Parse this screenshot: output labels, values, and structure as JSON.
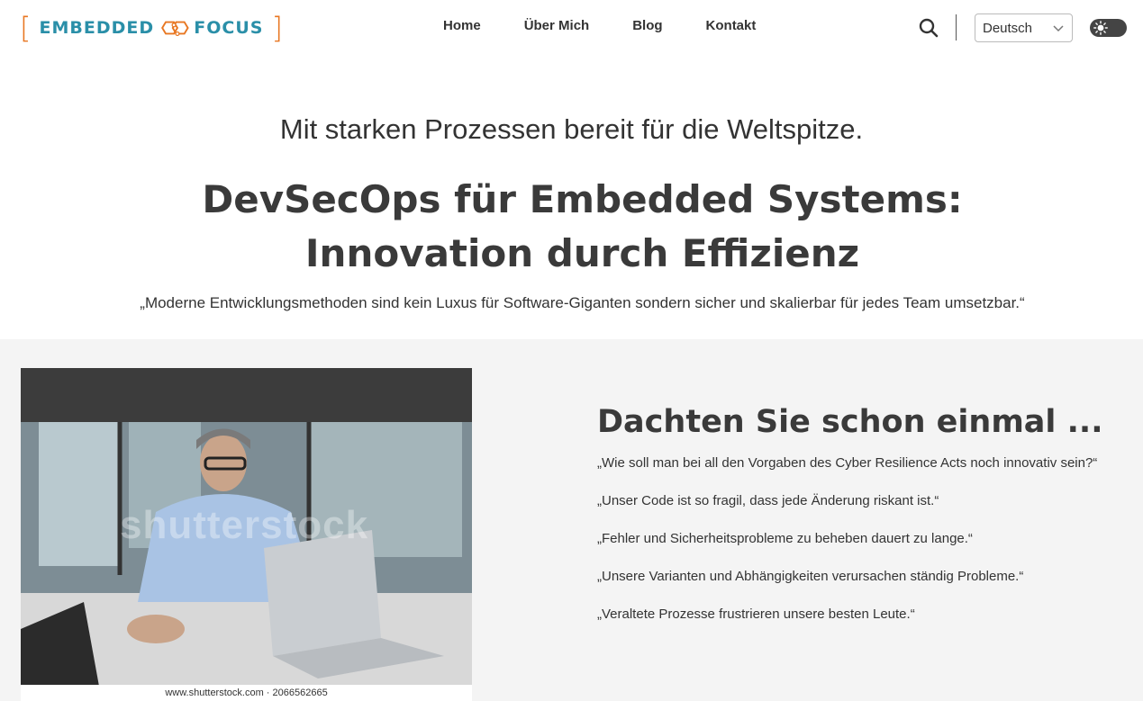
{
  "header": {
    "logo": {
      "left_word": "EMBEDDED",
      "right_word": "FOCUS",
      "accent_color": "#e87722",
      "text_color": "#2a8fa8"
    },
    "nav": [
      {
        "label": "Home"
      },
      {
        "label": "Über Mich"
      },
      {
        "label": "Blog"
      },
      {
        "label": "Kontakt"
      }
    ],
    "search_icon": "search-icon",
    "language": {
      "selected": "Deutsch"
    },
    "theme_toggle_icon": "sun-icon"
  },
  "hero": {
    "tagline": "Mit starken Prozessen bereit für die Weltspitze.",
    "headline_line1": "DevSecOps für Embedded Systems:",
    "headline_line2": "Innovation durch Effizienz",
    "quote": "„Moderne Entwicklungsmethoden sind kein Luxus für Software-Giganten sondern sicher und skalierbar für jedes Team umsetzbar.“"
  },
  "section": {
    "image_watermark": "shutterstock",
    "image_caption": "www.shutterstock.com · 2066562665",
    "title": "Dachten Sie schon einmal ...",
    "quotes": [
      "„Wie soll man bei all den Vorgaben des Cyber Resilience Acts noch innovativ sein?“",
      "„Unser Code ist so fragil, dass jede Änderung riskant ist.“",
      "„Fehler und Sicherheitsprobleme zu beheben dauert zu lange.“",
      "„Unsere Varianten und Abhängigkeiten verursachen ständig Probleme.“",
      "„Veraltete Prozesse frustrieren unsere besten Leute.“"
    ]
  }
}
